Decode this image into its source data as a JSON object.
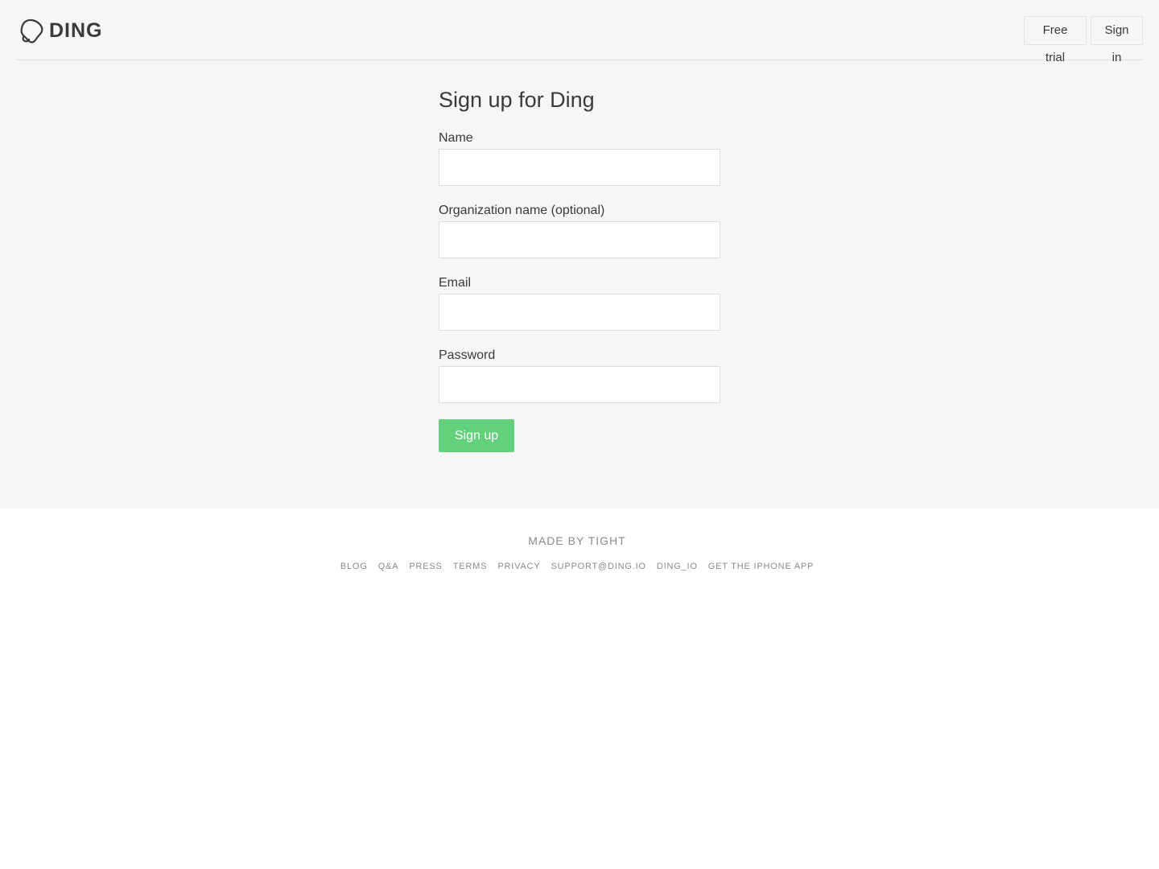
{
  "header": {
    "brand": "DING",
    "logo_icon": "bell-icon",
    "nav": {
      "free_trial": "Free trial",
      "sign_in": "Sign in"
    }
  },
  "form": {
    "title": "Sign up for Ding",
    "fields": [
      {
        "label": "Name",
        "value": "",
        "placeholder": ""
      },
      {
        "label": "Organization name (optional)",
        "value": "",
        "placeholder": ""
      },
      {
        "label": "Email",
        "value": "",
        "placeholder": ""
      },
      {
        "label": "Password",
        "value": "",
        "placeholder": ""
      }
    ],
    "submit_label": "Sign up"
  },
  "footer": {
    "made_by": "MADE BY TIGHT",
    "links": [
      "BLOG",
      "Q&A",
      "PRESS",
      "TERMS",
      "PRIVACY",
      "SUPPORT@DING.IO",
      "DING_IO",
      "GET THE IPHONE APP"
    ]
  },
  "colors": {
    "accent": "#63d07c",
    "background": "#f6f6f6",
    "text": "#3a3a3a",
    "muted": "#8a8a8a"
  }
}
